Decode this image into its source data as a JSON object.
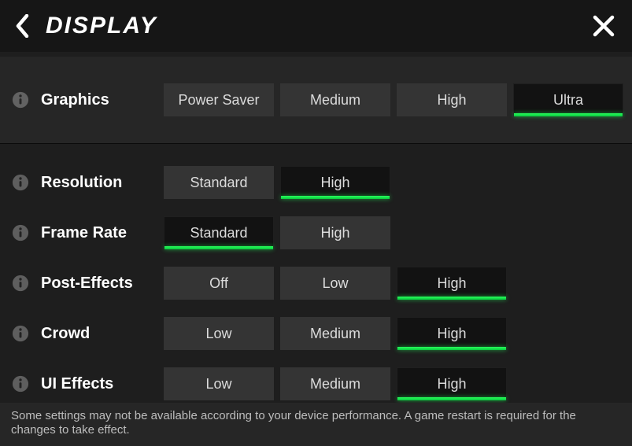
{
  "header": {
    "title": "DISPLAY"
  },
  "settings": [
    {
      "key": "graphics",
      "label": "Graphics",
      "hero": true,
      "options": [
        "Power Saver",
        "Medium",
        "High",
        "Ultra"
      ],
      "selected": 3
    },
    {
      "key": "resolution",
      "label": "Resolution",
      "hero": false,
      "options": [
        "Standard",
        "High"
      ],
      "selected": 1
    },
    {
      "key": "frame-rate",
      "label": "Frame Rate",
      "hero": false,
      "options": [
        "Standard",
        "High"
      ],
      "selected": 0
    },
    {
      "key": "post-effects",
      "label": "Post-Effects",
      "hero": false,
      "options": [
        "Off",
        "Low",
        "High"
      ],
      "selected": 2
    },
    {
      "key": "crowd",
      "label": "Crowd",
      "hero": false,
      "options": [
        "Low",
        "Medium",
        "High"
      ],
      "selected": 2
    },
    {
      "key": "ui-effects",
      "label": "UI Effects",
      "hero": false,
      "options": [
        "Low",
        "Medium",
        "High"
      ],
      "selected": 2
    }
  ],
  "footer": {
    "text": "Some settings may not be available according to your device performance. A game restart is required for the changes to take effect."
  },
  "colors": {
    "accent": "#16e64a"
  }
}
